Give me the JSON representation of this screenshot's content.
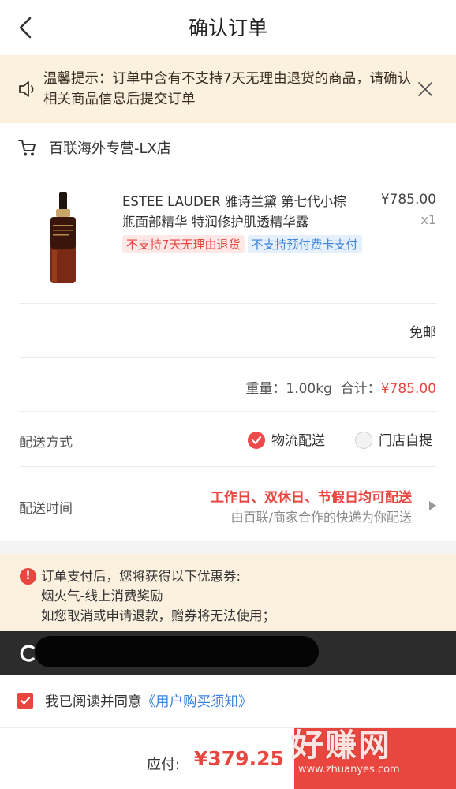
{
  "header": {
    "title": "确认订单"
  },
  "notice": {
    "text": "温馨提示：订单中含有不支持7天无理由退货的商品，请确认相关商品信息后提交订单"
  },
  "store": {
    "name": "百联海外专营-LX店"
  },
  "product": {
    "name": "ESTEE LAUDER 雅诗兰黛 第七代小棕瓶面部精华 特润修护肌透精华露",
    "price": "¥785.00",
    "qty": "x1",
    "tags": [
      "不支持7天无理由退货",
      "不支持预付费卡支付"
    ]
  },
  "shipping_fee": "免邮",
  "summary": {
    "weight_label": "重量：",
    "weight": "1.00kg",
    "total_label": "合计：",
    "total": "¥785.00"
  },
  "delivery_method": {
    "label": "配送方式",
    "options": [
      {
        "label": "物流配送",
        "selected": true
      },
      {
        "label": "门店自提",
        "selected": false
      }
    ]
  },
  "delivery_time": {
    "label": "配送时间",
    "line1": "工作日、双休日、节假日均可配送",
    "line2": "由百联/商家合作的快递为你配送"
  },
  "coupon": {
    "lines": [
      "订单支付后，您将获得以下优惠券:",
      "烟火气-线上消费奖励",
      "如您取消或申请退款，赠券将无法使用；"
    ]
  },
  "agreement": {
    "text": "我已阅读并同意",
    "link": "《用户购买须知》"
  },
  "footer": {
    "label": "应付:",
    "amount": "¥379.25"
  },
  "watermark": {
    "main": "好赚网",
    "sub": "www.zhuanyes.com"
  },
  "colors": {
    "accent": "#e8463e",
    "link": "#3b83dd",
    "notice_bg": "#fcf0df"
  }
}
